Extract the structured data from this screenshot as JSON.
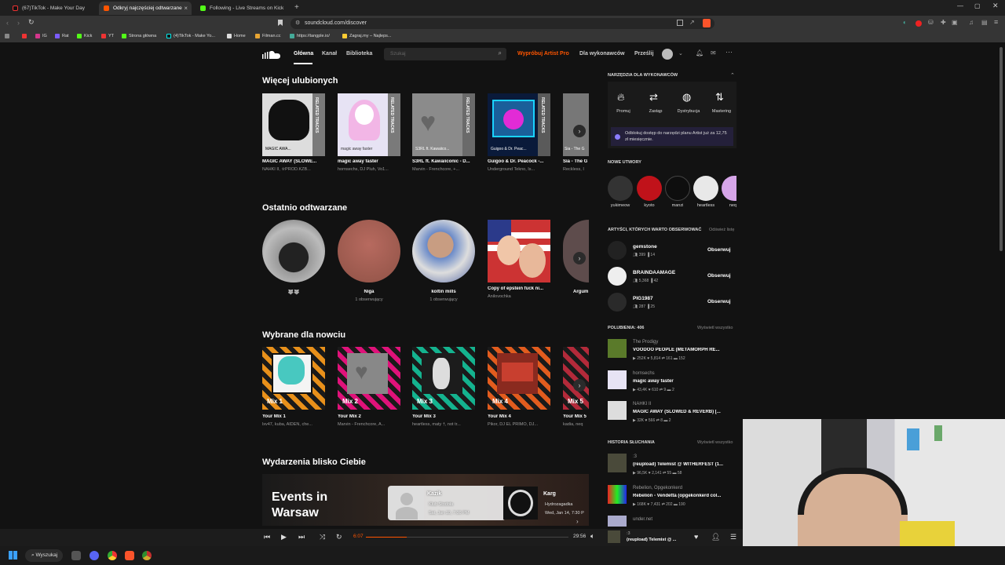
{
  "browser": {
    "tabs": [
      {
        "label": "(67)TikTok - Make Your Day",
        "color": "#111"
      },
      {
        "label": "Odkryj najczęściej odtwarzane u",
        "color": "#ff5500"
      },
      {
        "label": "Following - Live Streams on Kick",
        "color": "#53fc18"
      }
    ],
    "new_tab": "+",
    "url": "soundcloud.com/discover",
    "bookmarks": [
      "IG",
      "Rat",
      "Kick",
      "YT",
      "Strona główna",
      "(4)TikTok - Make Yo...",
      "Home",
      "Filman.cc",
      "https://tangple.io/",
      "Zagraj.my – Najleps..."
    ]
  },
  "nav": {
    "home": "Główna",
    "feed": "Kanał",
    "library": "Biblioteka",
    "search_placeholder": "Szukaj",
    "artist_pro": "Wypróbuj Artist Pro",
    "for_artists": "Dla wykonawców",
    "upload": "Prześlij"
  },
  "sections": {
    "more_favs": {
      "title": "Więcej ulubionych",
      "items": [
        {
          "title": "MAGIC AWAY (SLOWE...",
          "sub": "NAHKI II, ✮PROD.KZB...",
          "overlay": "MAGIC AWA..."
        },
        {
          "title": "magic away faster",
          "sub": "hornsechs, DJ Pluh, Vo1...",
          "overlay": "magic away faster"
        },
        {
          "title": "S3RL ft. Kawaiiconic - D...",
          "sub": "Marvin - Frenchcore, +...",
          "overlay": "S3RL ft. Kawaiico..."
        },
        {
          "title": "Guigoo & Dr. Peacock -...",
          "sub": "Underground Tekno, Is...",
          "overlay": "Guigoo & Dr. Peac..."
        },
        {
          "title": "Sia - The G",
          "sub": "Reckless, I",
          "overlay": "Sia - The G"
        }
      ],
      "badge": "RELATED TRACKS"
    },
    "recent": {
      "title": "Ostatnio odtwarzane",
      "items": [
        {
          "title": "🐺🐺",
          "sub": ""
        },
        {
          "title": "Niga",
          "sub": "1 obserwujący"
        },
        {
          "title": "koltin mills",
          "sub": "1 obserwujący"
        },
        {
          "title": "Copy of epstein fuck ni...",
          "sub": "Anilovochka"
        },
        {
          "title": "Argum",
          "sub": ""
        }
      ]
    },
    "picked": {
      "title": "Wybrane dla nowciu",
      "items": [
        {
          "title": "Your Mix 1",
          "sub": "lxv47, kuba, AIDEN, che...",
          "tag": "Mix 1"
        },
        {
          "title": "Your Mix 2",
          "sub": "Marvin - Frenchcore, A...",
          "tag": "Mix 2"
        },
        {
          "title": "Your Mix 3",
          "sub": "heartless, maty †, not tr...",
          "tag": "Mix 3"
        },
        {
          "title": "Your Mix 4",
          "sub": "Pikor, DJ EL PRIMO, DJ...",
          "tag": "Mix 4"
        },
        {
          "title": "Your Mix 5",
          "sub": "kadia, neq",
          "tag": "Mix 5"
        }
      ]
    },
    "events": {
      "title": "Wydarzenia blisko Ciebie",
      "banner": "Events in Warsaw",
      "cards": [
        {
          "name": "Kazik",
          "venue": "Klub Stodoła",
          "date": "Sat, Jan 10, 7:00 PM"
        },
        {
          "name": "Karg",
          "venue": "Hydrozagadka",
          "date": "Wed, Jan 14, 7:30 P"
        }
      ]
    }
  },
  "sidebar": {
    "tools": {
      "title": "Narzędzia dla wykonawców",
      "items": [
        "Promuj",
        "Zastąp",
        "Dystrybucja",
        "Mastering"
      ],
      "promo": "Odblokuj dostęp do narzędzi planu Artist już za 12,75 zł miesięcznie."
    },
    "new_tracks": {
      "title": "Nowe utwory",
      "artists": [
        "yukimeow",
        "kyoto",
        "manzi",
        "heartless",
        "neq"
      ]
    },
    "follow": {
      "title": "Artyści, których warto obserwować",
      "refresh": "Odśwież listę",
      "button": "Obserwuj",
      "items": [
        {
          "name": "gemstone",
          "followers": "399",
          "tracks": "14"
        },
        {
          "name": "BRAINDAAMAGE",
          "followers": "5,368",
          "tracks": "42"
        },
        {
          "name": "PIG1987",
          "followers": "287",
          "tracks": "25"
        }
      ]
    },
    "likes": {
      "title": "Polubienia: 406",
      "view_all": "Wyświetl wszystko",
      "items": [
        {
          "artist": "The Prodigy",
          "title": "VOODOO PEOPLE (METAMORPH RE...",
          "plays": "252K",
          "likes": "5,814",
          "reposts": "161",
          "comments": "152"
        },
        {
          "artist": "hornsechs",
          "title": "magic away faster",
          "plays": "43,4K",
          "likes": "610",
          "reposts": "9",
          "comments": "2"
        },
        {
          "artist": "NAHKI II",
          "title": "MAGIC AWAY (SLOWED & REVERB) [...",
          "plays": "32K",
          "likes": "566",
          "reposts": "8",
          "comments": "2"
        }
      ]
    },
    "history": {
      "title": "Historia słuchania",
      "view_all": "Wyświetl wszystko",
      "items": [
        {
          "artist": ":3",
          "title": "(reupload) Telemist @ WITHERFEST (1...",
          "plays": "96,5K",
          "likes": "2,141",
          "reposts": "55",
          "comments": "58"
        },
        {
          "artist": "Rebelion, Opgekonkerd",
          "title": "Rebelion - Vendetta (opgekonkerd col...",
          "plays": "168K",
          "likes": "7,431",
          "reposts": "202",
          "comments": "190"
        },
        {
          "artist": "under.net",
          "title": "",
          "plays": "",
          "likes": "",
          "reposts": "",
          "comments": ""
        }
      ]
    }
  },
  "player": {
    "elapsed": "6:07",
    "total": "29:56",
    "artist": ":3",
    "title": "(reupload) Telemist @ ...",
    "progress": 0.2
  },
  "taskbar": {
    "search": "Wyszukaj"
  }
}
